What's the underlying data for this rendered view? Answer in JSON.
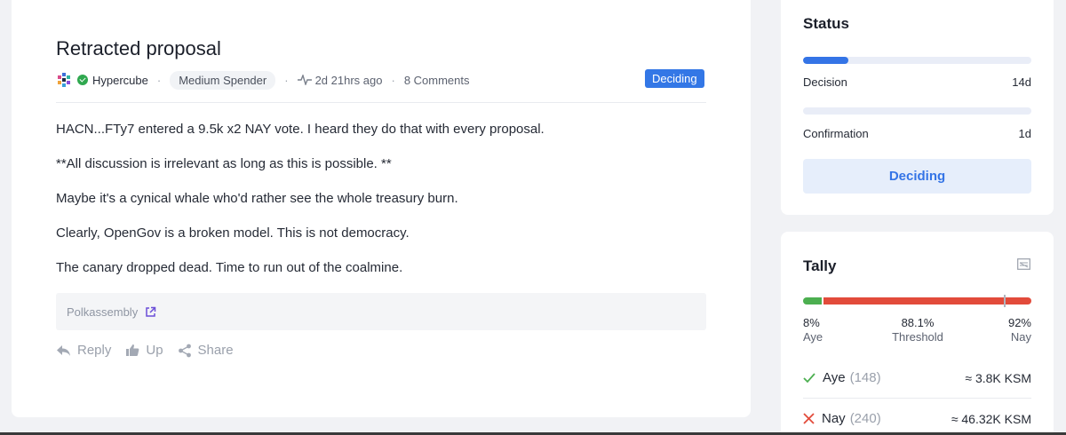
{
  "post": {
    "title": "Retracted proposal",
    "author": "Hypercube",
    "role_tag": "Medium Spender",
    "separator": "·",
    "time_ago": "2d 21hrs ago",
    "comments": "8 Comments",
    "status_badge": "Deciding",
    "body": [
      "HACN...FTy7 entered a 9.5k x2 NAY vote. I heard they do that with every proposal.",
      "**All discussion is irrelevant as long as this is possible. **",
      "Maybe it's a cynical whale who'd rather see the whole treasury burn.",
      "Clearly, OpenGov is a broken model. This is not democracy.",
      "The canary dropped dead. Time to run out of the coalmine."
    ],
    "source_label": "Polkassembly",
    "actions": {
      "reply": "Reply",
      "up": "Up",
      "share": "Share"
    }
  },
  "status": {
    "title": "Status",
    "decision_label": "Decision",
    "decision_value": "14d",
    "decision_progress": 0.2,
    "confirmation_label": "Confirmation",
    "confirmation_value": "1d",
    "confirmation_progress": 0,
    "button_label": "Deciding"
  },
  "tally": {
    "title": "Tally",
    "aye_pct": "8%",
    "aye_label": "Aye",
    "threshold_pct": "88.1%",
    "threshold_label": "Threshold",
    "nay_pct": "92%",
    "nay_label": "Nay",
    "aye_fraction": 0.08,
    "threshold_fraction": 0.881,
    "aye_row": {
      "label": "Aye",
      "count": "(148)",
      "amount": "≈ 3.8K KSM"
    },
    "nay_row": {
      "label": "Nay",
      "count": "(240)",
      "amount": "≈ 46.32K KSM"
    }
  },
  "colors": {
    "accent": "#3474e6",
    "aye": "#4caf50",
    "nay": "#e24b3b"
  }
}
